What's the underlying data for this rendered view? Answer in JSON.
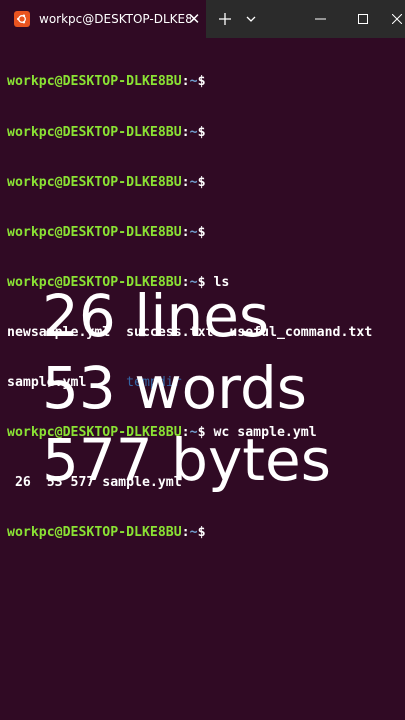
{
  "tab": {
    "title": "workpc@DESKTOP-DLKE8BU:"
  },
  "terminal": {
    "prompt_user": "workpc@DESKTOP-DLKE8BU",
    "prompt_path": "~",
    "lines": [
      {
        "cmd": ""
      },
      {
        "cmd": ""
      },
      {
        "cmd": ""
      },
      {
        "cmd": ""
      },
      {
        "cmd": " ls"
      },
      {
        "output": [
          "newsample.yml",
          "success.txt",
          "useful_command.txt"
        ]
      },
      {
        "output": [
          "sample.yml",
          "tempdir"
        ]
      },
      {
        "cmd": " wc sample.yml"
      },
      {
        "output_text": " 26  53 577 sample.yml"
      },
      {
        "cmd": ""
      }
    ]
  },
  "caption": {
    "line1": "26 lines",
    "line2": "53 words",
    "line3": "577 bytes"
  },
  "colors": {
    "background": "#300a24",
    "user": "#8ae234",
    "path": "#729fcf",
    "dir": "#3465a4"
  }
}
